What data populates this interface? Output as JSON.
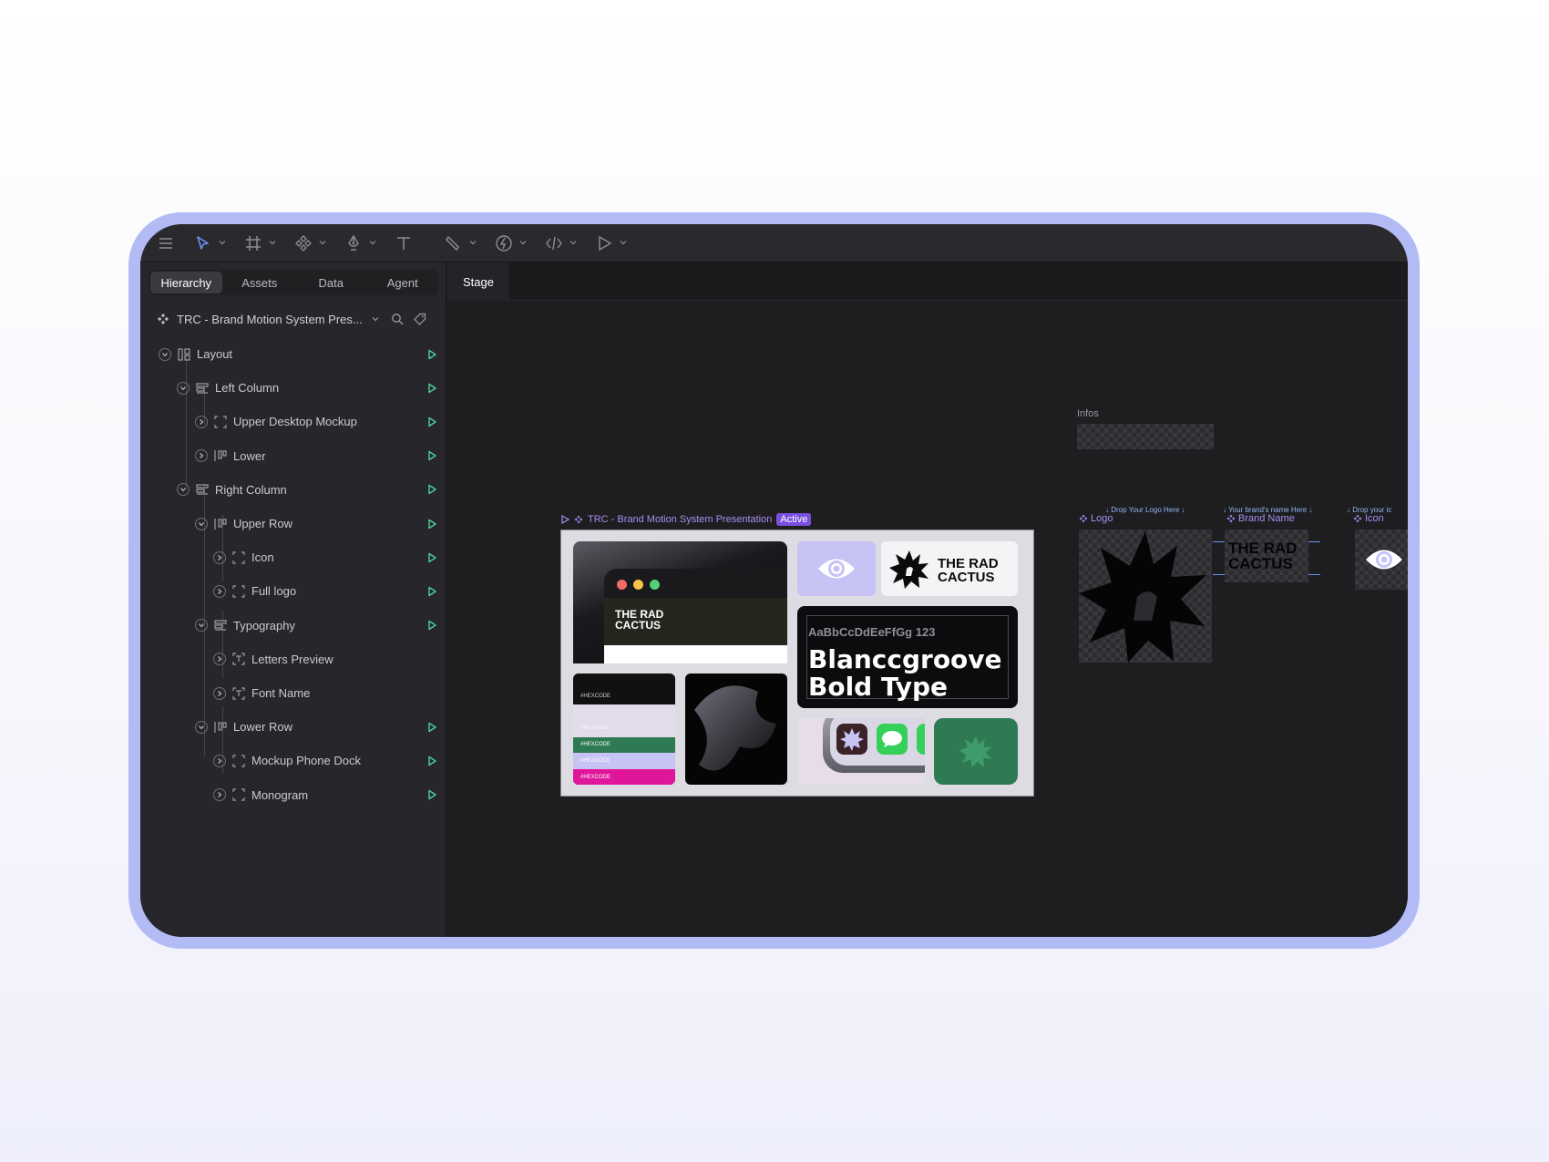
{
  "sidebar": {
    "tabs": [
      "Hierarchy",
      "Assets",
      "Data",
      "Agent"
    ],
    "active_tab": "Hierarchy",
    "project_name": "TRC - Brand Motion System Pres...",
    "tree": [
      {
        "label": "Layout",
        "icon": "layout-icon",
        "play": true
      },
      {
        "label": "Left Column",
        "icon": "stack-icon",
        "play": true
      },
      {
        "label": "Upper Desktop Mockup",
        "icon": "frame-icon",
        "play": true
      },
      {
        "label": "Lower",
        "icon": "row-icon",
        "play": true
      },
      {
        "label": "Right Column",
        "icon": "stack-icon",
        "play": true
      },
      {
        "label": "Upper Row",
        "icon": "row-icon",
        "play": true
      },
      {
        "label": "Icon",
        "icon": "frame-icon",
        "play": true
      },
      {
        "label": "Full logo",
        "icon": "frame-icon",
        "play": true
      },
      {
        "label": "Typography",
        "icon": "stack-icon",
        "play": true
      },
      {
        "label": "Letters Preview",
        "icon": "text-icon",
        "play": false
      },
      {
        "label": "Font Name",
        "icon": "text-icon",
        "play": false
      },
      {
        "label": "Lower Row",
        "icon": "row-icon",
        "play": true
      },
      {
        "label": "Mockup Phone Dock",
        "icon": "frame-icon",
        "play": true
      },
      {
        "label": "Monogram",
        "icon": "frame-icon",
        "play": true
      }
    ]
  },
  "stage": {
    "tab": "Stage",
    "infos_label": "Infos",
    "component_title": "TRC - Brand Motion System Presentation",
    "component_badge": "Active",
    "brand_name_line1": "THE RAD",
    "brand_name_line2": "CACTUS",
    "hexcode": "#HEXCODE",
    "type_preview": "AaBbCcDdEeFfGg 123",
    "type_name_line1": "Blanccgroove",
    "type_name_line2": "Bold Type",
    "slots": [
      {
        "label": "Logo",
        "hint": "↓ Drop Your Logo Here ↓"
      },
      {
        "label": "Brand Name",
        "hint": "↓ Your brand's name Here ↓"
      },
      {
        "label": "Icon",
        "hint": "↓ Drop your ic"
      }
    ]
  },
  "colors": {
    "frame": "#b3bbf5",
    "accent_purple": "#a98cf0",
    "play_green": "#4ecf9a",
    "brand_green": "#2e7a52",
    "lavender": "#c7c3f5",
    "pink": "#e0169a"
  }
}
